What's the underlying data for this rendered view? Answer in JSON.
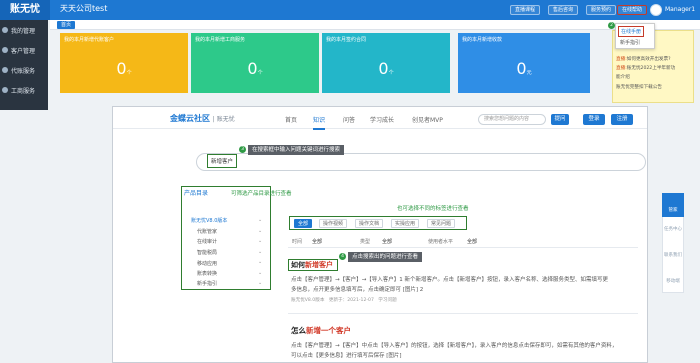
{
  "app": {
    "logo": "账无忧",
    "company": "天天公司test",
    "user": "Manager1"
  },
  "topbar": {
    "buttons": [
      "直播课程",
      "售后咨询",
      "服务预约",
      "在线帮助"
    ],
    "dropdown": {
      "items": [
        "在线手册",
        "新手指引"
      ]
    }
  },
  "sidebar": {
    "items": [
      "我的管理",
      "客户管理",
      "代账服务",
      "工商服务"
    ]
  },
  "tabs": {
    "home": "首页"
  },
  "cards": [
    {
      "title": "我的本月新增代账客户",
      "value": "0",
      "unit": "个",
      "color": "#f5b817"
    },
    {
      "title": "我的本月新增工商服务",
      "value": "0",
      "unit": "个",
      "color": "#2dc98a"
    },
    {
      "title": "我的本月签约合同",
      "value": "0",
      "unit": "个",
      "color": "#23b6c9"
    },
    {
      "title": "我的本月新增收款",
      "value": "0",
      "unit": "元",
      "color": "#2f8ee6"
    }
  ],
  "notice": {
    "lines": [
      {
        "tag": "直播:",
        "text": "如何更高效开出发票?"
      },
      {
        "tag": "直播:",
        "text": "账无忧2022上半年新功"
      },
      {
        "tag": "",
        "text": "能介绍"
      },
      {
        "tag": "",
        "text": "账无忧完整扣下载公告"
      }
    ]
  },
  "site": {
    "logo": "金蝶云社区",
    "logo_sub": "| 账无忧",
    "nav": [
      "首页",
      "知识",
      "问答",
      "学习成长",
      "创见者MVP"
    ],
    "search_placeholder": "搜索您想问题的内容",
    "ask": "提问",
    "login": "登录",
    "register": "注册"
  },
  "search": {
    "keyword": "新增客户"
  },
  "annotations": {
    "a3": "在搜索框中输入问题关键词进行搜索",
    "a3num": "3",
    "a2num": "2",
    "cat_hint": "可筛选产品目录进行查看",
    "tag_hint": "也可选择不同的标签进行查看",
    "a4": "点击搜索出的问题进行查看",
    "a4num": "4"
  },
  "catalog": {
    "title": "产品目录",
    "items": [
      "账无忧V8.0版本",
      "代账管家",
      "在线审计",
      "智能税局",
      "移动应用",
      "账表转换",
      "新手指引"
    ]
  },
  "filters": {
    "tags": [
      "全部",
      "操作视频",
      "操作文档",
      "实操应用",
      "常见问题"
    ],
    "row": [
      {
        "label": "时间",
        "value": "全部"
      },
      {
        "label": "类型",
        "value": "全部"
      },
      {
        "label": "使用者水平",
        "value": "全部"
      }
    ]
  },
  "articles": [
    {
      "title_prefix": "如何",
      "title_hl": "新增客户",
      "line1": "点击【客户管理】→【客户】→【导入客户】1 新个新增客户。点击【新增客户】按钮，录入客户名称、选择服务类型、如需填写更",
      "line2": "多信息，点开更多信息填写后，点击确定即可 [图片] 2",
      "meta": [
        "账无忧V8.0版本",
        "更新于：2021-12-07",
        "学习问题"
      ]
    },
    {
      "title_prefix": "怎么",
      "title_hl": "新增一个客户",
      "line1": "点击【客户管理】→【客户】中点击【导入客户】的按钮，选择【新增客户】，录入客户的信息点击保存即可，如需有其他的客户资料，",
      "line2": "可以点击【更多信息】进行填写后保存 [图片]"
    }
  ],
  "rightfloat": {
    "items": [
      "管家",
      "任务中心",
      "联系我们",
      "移动端"
    ]
  }
}
